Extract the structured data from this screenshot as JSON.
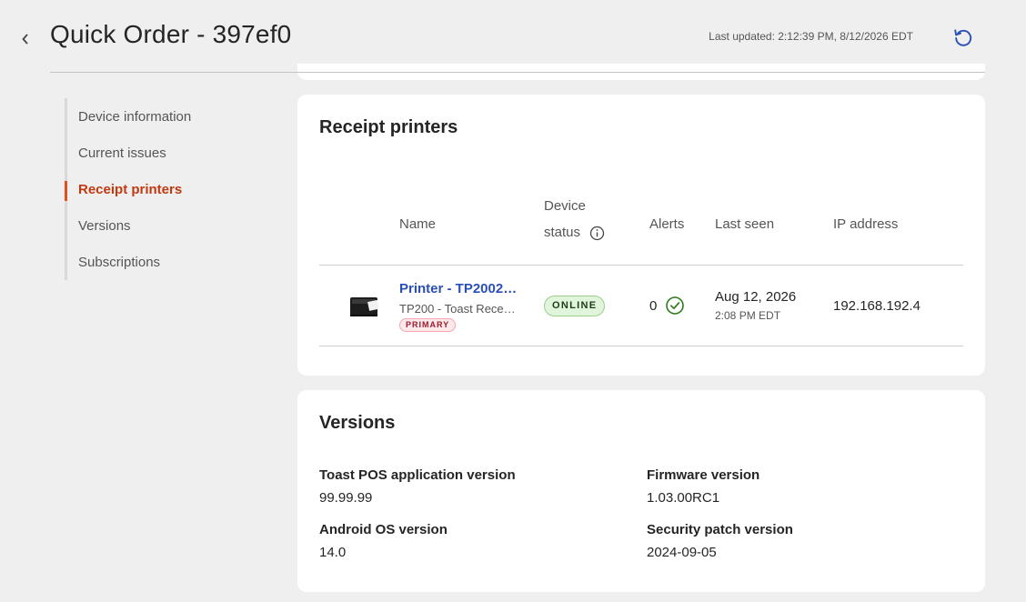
{
  "header": {
    "title": "Quick Order - 397ef0",
    "last_updated": "Last updated: 2:12:39 PM, 8/12/2026 EDT"
  },
  "sidebar": {
    "items": [
      {
        "label": "Device information",
        "active": false
      },
      {
        "label": "Current issues",
        "active": false
      },
      {
        "label": "Receipt printers",
        "active": true
      },
      {
        "label": "Versions",
        "active": false
      },
      {
        "label": "Subscriptions",
        "active": false
      }
    ]
  },
  "printers": {
    "title": "Receipt printers",
    "columns": {
      "name": "Name",
      "status_line1": "Device",
      "status_line2": "status",
      "alerts": "Alerts",
      "last_seen": "Last seen",
      "ip": "IP address"
    },
    "rows": [
      {
        "name": "Printer - TP2002…",
        "model": "TP200 - Toast Rece…",
        "badge": "PRIMARY",
        "status": "ONLINE",
        "alerts": "0",
        "last_seen_date": "Aug 12, 2026",
        "last_seen_time": "2:08 PM EDT",
        "ip": "192.168.192.4"
      }
    ]
  },
  "versions": {
    "title": "Versions",
    "items": [
      {
        "label": "Toast POS application version",
        "value": "99.99.99"
      },
      {
        "label": "Firmware version",
        "value": "1.03.00RC1"
      },
      {
        "label": "Android OS version",
        "value": "14.0"
      },
      {
        "label": "Security patch version",
        "value": "2024-09-05"
      }
    ]
  },
  "colors": {
    "accent": "#e4501c",
    "link": "#2b4fb8",
    "refresh": "#2b4fb8",
    "online_bg": "#e1f4dc",
    "check": "#2f7a1f"
  },
  "icons": [
    "chevron-left-icon",
    "refresh-icon",
    "info-icon",
    "check-circle-icon",
    "printer-icon"
  ]
}
